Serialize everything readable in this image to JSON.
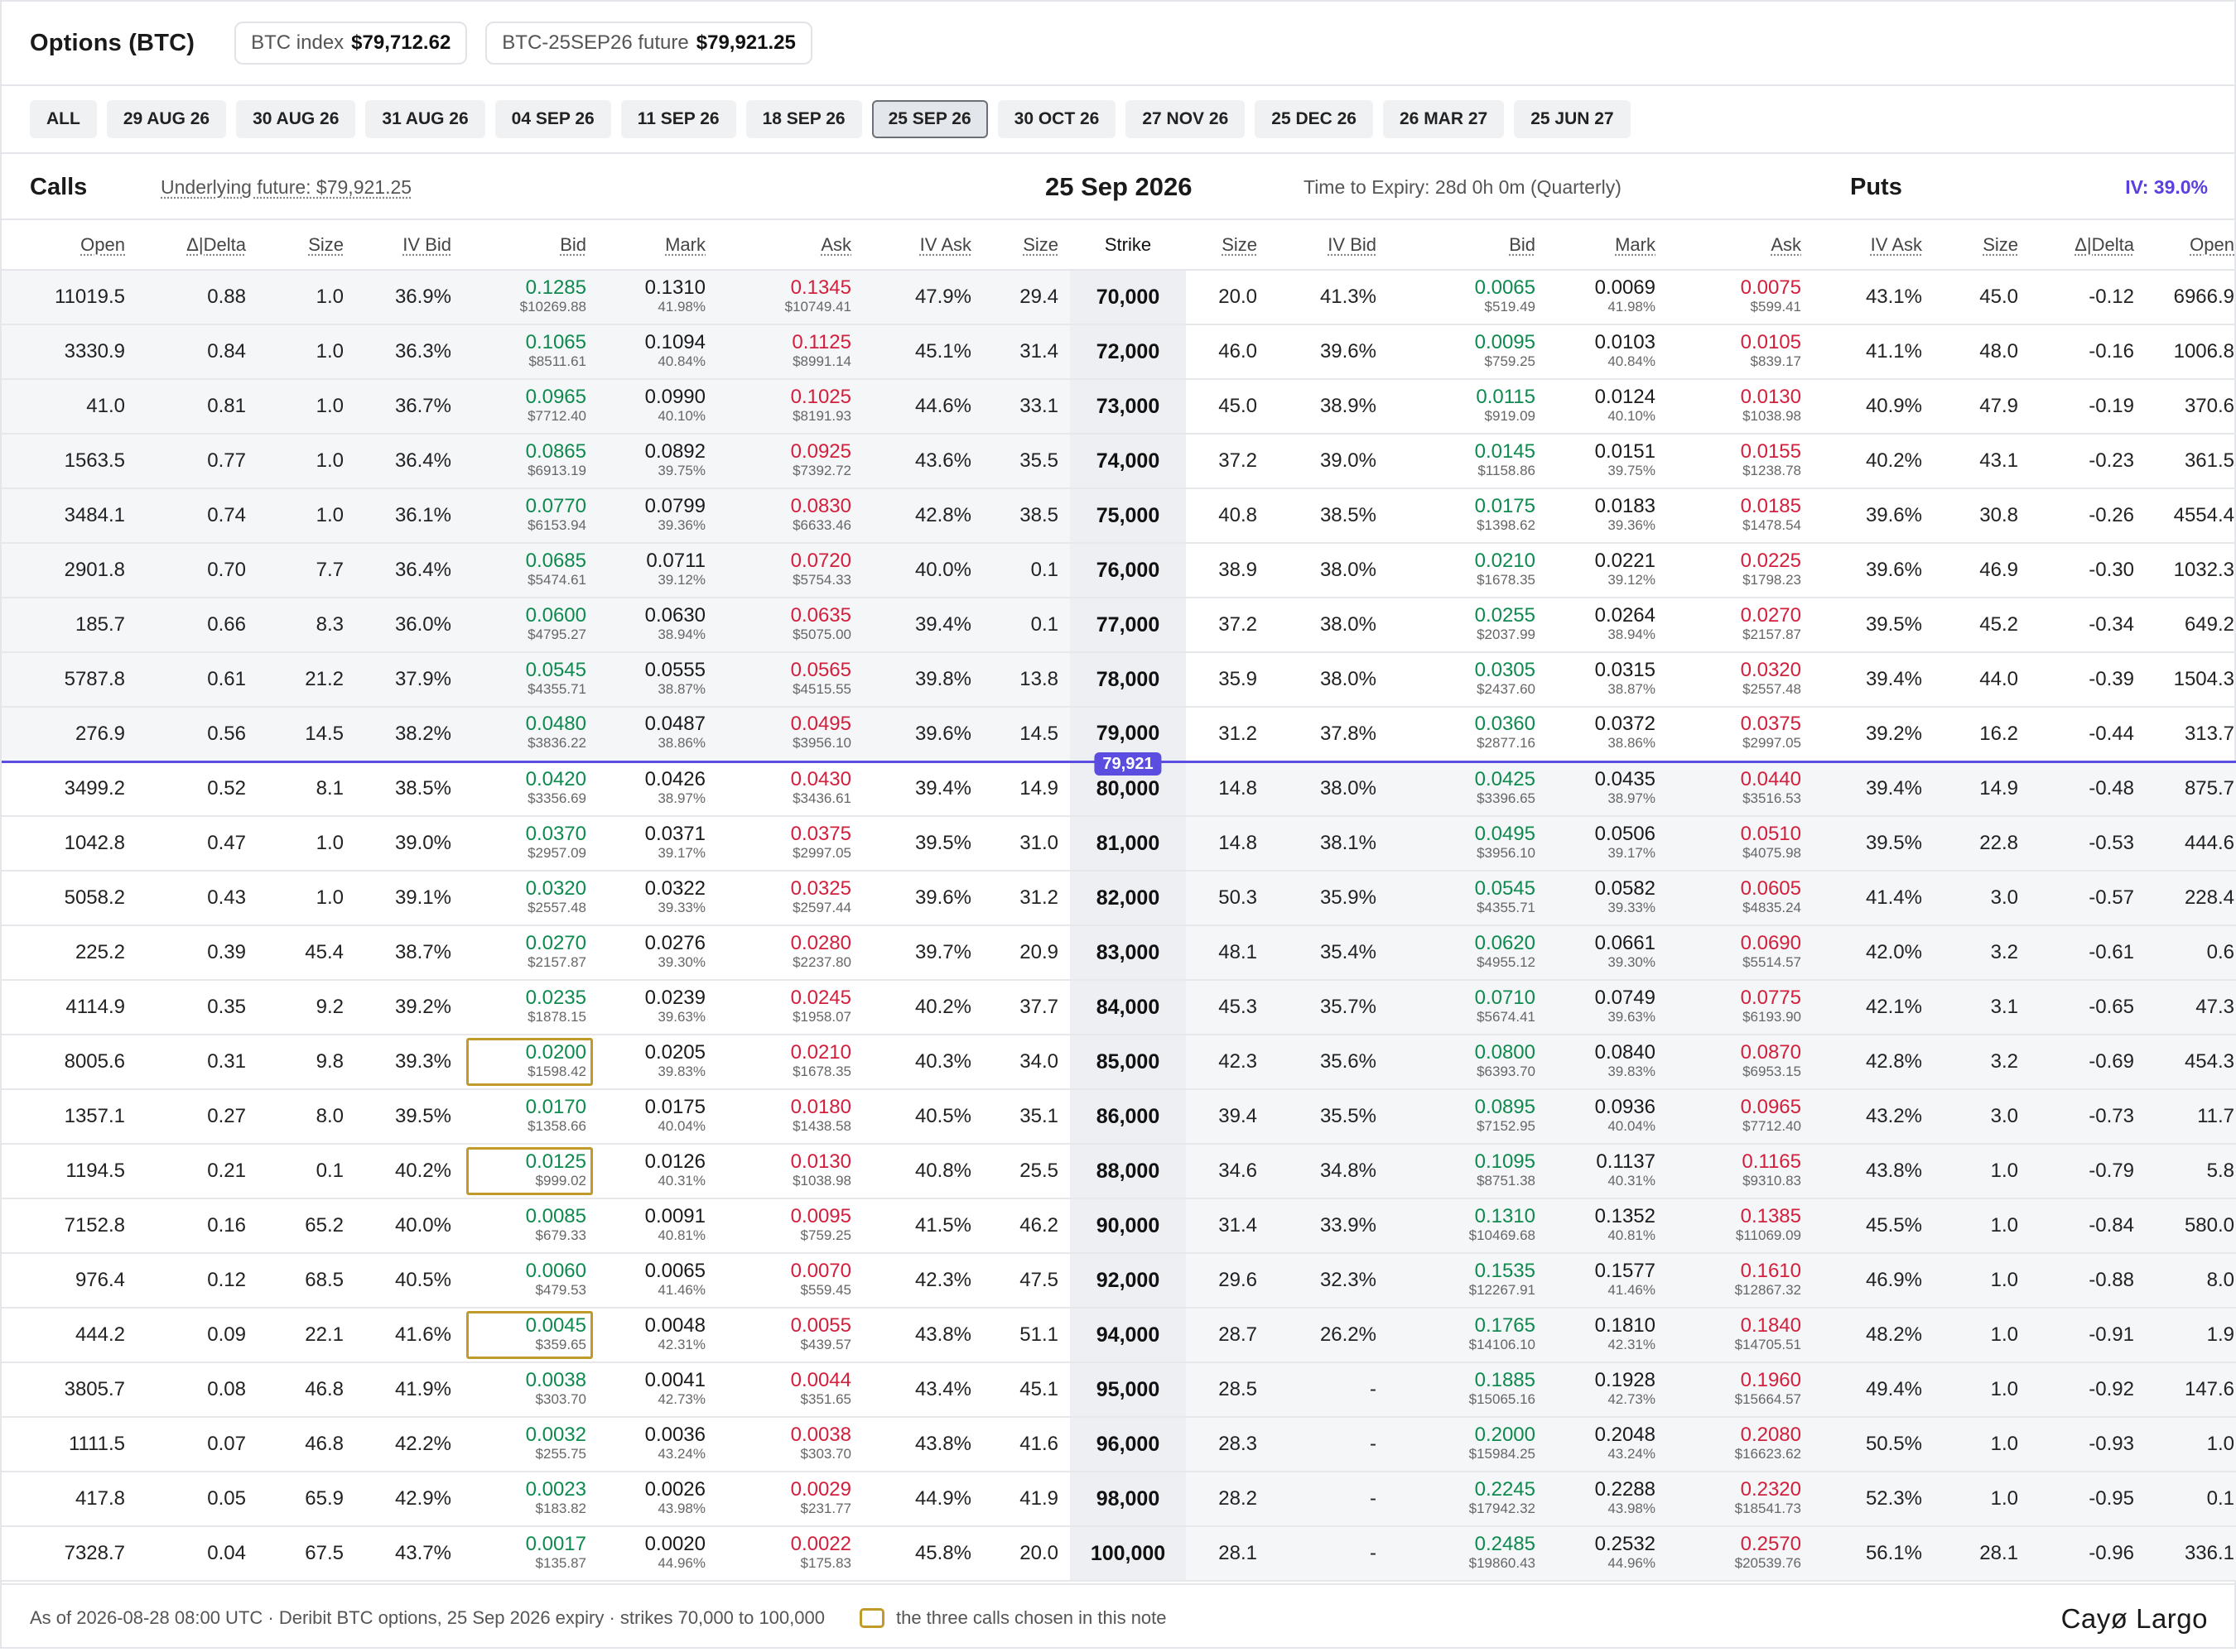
{
  "header": {
    "title": "Options (BTC)",
    "index_label": "BTC index",
    "index_value": "$79,712.62",
    "future_label": "BTC-25SEP26 future",
    "future_value": "$79,921.25"
  },
  "expiries": [
    "ALL",
    "29 AUG 26",
    "30 AUG 26",
    "31 AUG 26",
    "04 SEP 26",
    "11 SEP 26",
    "18 SEP 26",
    "25 SEP 26",
    "30 OCT 26",
    "27 NOV 26",
    "25 DEC 26",
    "26 MAR 27",
    "25 JUN 27"
  ],
  "selected_expiry": "25 SEP 26",
  "section": {
    "calls_label": "Calls",
    "underlying": "Underlying future: $79,921.25",
    "expiry_date": "25 Sep 2026",
    "time_to_expiry": "Time to Expiry: 28d 0h 0m (Quarterly)",
    "puts_label": "Puts",
    "iv": "IV: 39.0%"
  },
  "columns": {
    "calls": [
      "Open",
      "Δ|Delta",
      "Size",
      "IV Bid",
      "Bid",
      "Mark",
      "Ask",
      "IV Ask",
      "Size"
    ],
    "strike": "Strike",
    "puts": [
      "Size",
      "IV Bid",
      "Bid",
      "Mark",
      "Ask",
      "IV Ask",
      "Size",
      "Δ|Delta",
      "Open"
    ]
  },
  "atm_marker": "79,921",
  "highlight_color": "#c29a2a",
  "rows": [
    {
      "strike": "70,000",
      "c": [
        "11019.5",
        "0.88",
        "1.0",
        "36.9%",
        [
          "0.1285",
          "$10269.88"
        ],
        [
          "0.1310",
          "41.98%"
        ],
        [
          "0.1345",
          "$10749.41"
        ],
        "47.9%",
        "29.4"
      ],
      "p": [
        "20.0",
        "41.3%",
        [
          "0.0065",
          "$519.49"
        ],
        [
          "0.0069",
          "41.98%"
        ],
        [
          "0.0075",
          "$599.41"
        ],
        "43.1%",
        "45.0",
        "-0.12",
        "6966.9"
      ]
    },
    {
      "strike": "72,000",
      "c": [
        "3330.9",
        "0.84",
        "1.0",
        "36.3%",
        [
          "0.1065",
          "$8511.61"
        ],
        [
          "0.1094",
          "40.84%"
        ],
        [
          "0.1125",
          "$8991.14"
        ],
        "45.1%",
        "31.4"
      ],
      "p": [
        "46.0",
        "39.6%",
        [
          "0.0095",
          "$759.25"
        ],
        [
          "0.0103",
          "40.84%"
        ],
        [
          "0.0105",
          "$839.17"
        ],
        "41.1%",
        "48.0",
        "-0.16",
        "1006.8"
      ]
    },
    {
      "strike": "73,000",
      "c": [
        "41.0",
        "0.81",
        "1.0",
        "36.7%",
        [
          "0.0965",
          "$7712.40"
        ],
        [
          "0.0990",
          "40.10%"
        ],
        [
          "0.1025",
          "$8191.93"
        ],
        "44.6%",
        "33.1"
      ],
      "p": [
        "45.0",
        "38.9%",
        [
          "0.0115",
          "$919.09"
        ],
        [
          "0.0124",
          "40.10%"
        ],
        [
          "0.0130",
          "$1038.98"
        ],
        "40.9%",
        "47.9",
        "-0.19",
        "370.6"
      ]
    },
    {
      "strike": "74,000",
      "c": [
        "1563.5",
        "0.77",
        "1.0",
        "36.4%",
        [
          "0.0865",
          "$6913.19"
        ],
        [
          "0.0892",
          "39.75%"
        ],
        [
          "0.0925",
          "$7392.72"
        ],
        "43.6%",
        "35.5"
      ],
      "p": [
        "37.2",
        "39.0%",
        [
          "0.0145",
          "$1158.86"
        ],
        [
          "0.0151",
          "39.75%"
        ],
        [
          "0.0155",
          "$1238.78"
        ],
        "40.2%",
        "43.1",
        "-0.23",
        "361.5"
      ]
    },
    {
      "strike": "75,000",
      "c": [
        "3484.1",
        "0.74",
        "1.0",
        "36.1%",
        [
          "0.0770",
          "$6153.94"
        ],
        [
          "0.0799",
          "39.36%"
        ],
        [
          "0.0830",
          "$6633.46"
        ],
        "42.8%",
        "38.5"
      ],
      "p": [
        "40.8",
        "38.5%",
        [
          "0.0175",
          "$1398.62"
        ],
        [
          "0.0183",
          "39.36%"
        ],
        [
          "0.0185",
          "$1478.54"
        ],
        "39.6%",
        "30.8",
        "-0.26",
        "4554.4"
      ]
    },
    {
      "strike": "76,000",
      "c": [
        "2901.8",
        "0.70",
        "7.7",
        "36.4%",
        [
          "0.0685",
          "$5474.61"
        ],
        [
          "0.0711",
          "39.12%"
        ],
        [
          "0.0720",
          "$5754.33"
        ],
        "40.0%",
        "0.1"
      ],
      "p": [
        "38.9",
        "38.0%",
        [
          "0.0210",
          "$1678.35"
        ],
        [
          "0.0221",
          "39.12%"
        ],
        [
          "0.0225",
          "$1798.23"
        ],
        "39.6%",
        "46.9",
        "-0.30",
        "1032.3"
      ]
    },
    {
      "strike": "77,000",
      "c": [
        "185.7",
        "0.66",
        "8.3",
        "36.0%",
        [
          "0.0600",
          "$4795.27"
        ],
        [
          "0.0630",
          "38.94%"
        ],
        [
          "0.0635",
          "$5075.00"
        ],
        "39.4%",
        "0.1"
      ],
      "p": [
        "37.2",
        "38.0%",
        [
          "0.0255",
          "$2037.99"
        ],
        [
          "0.0264",
          "38.94%"
        ],
        [
          "0.0270",
          "$2157.87"
        ],
        "39.5%",
        "45.2",
        "-0.34",
        "649.2"
      ]
    },
    {
      "strike": "78,000",
      "c": [
        "5787.8",
        "0.61",
        "21.2",
        "37.9%",
        [
          "0.0545",
          "$4355.71"
        ],
        [
          "0.0555",
          "38.87%"
        ],
        [
          "0.0565",
          "$4515.55"
        ],
        "39.8%",
        "13.8"
      ],
      "p": [
        "35.9",
        "38.0%",
        [
          "0.0305",
          "$2437.60"
        ],
        [
          "0.0315",
          "38.87%"
        ],
        [
          "0.0320",
          "$2557.48"
        ],
        "39.4%",
        "44.0",
        "-0.39",
        "1504.3"
      ]
    },
    {
      "strike": "79,000",
      "c": [
        "276.9",
        "0.56",
        "14.5",
        "38.2%",
        [
          "0.0480",
          "$3836.22"
        ],
        [
          "0.0487",
          "38.86%"
        ],
        [
          "0.0495",
          "$3956.10"
        ],
        "39.6%",
        "14.5"
      ],
      "p": [
        "31.2",
        "37.8%",
        [
          "0.0360",
          "$2877.16"
        ],
        [
          "0.0372",
          "38.86%"
        ],
        [
          "0.0375",
          "$2997.05"
        ],
        "39.2%",
        "16.2",
        "-0.44",
        "313.7"
      ]
    },
    {
      "strike": "80,000",
      "c": [
        "3499.2",
        "0.52",
        "8.1",
        "38.5%",
        [
          "0.0420",
          "$3356.69"
        ],
        [
          "0.0426",
          "38.97%"
        ],
        [
          "0.0430",
          "$3436.61"
        ],
        "39.4%",
        "14.9"
      ],
      "p": [
        "14.8",
        "38.0%",
        [
          "0.0425",
          "$3396.65"
        ],
        [
          "0.0435",
          "38.97%"
        ],
        [
          "0.0440",
          "$3516.53"
        ],
        "39.4%",
        "14.9",
        "-0.48",
        "875.7"
      ]
    },
    {
      "strike": "81,000",
      "c": [
        "1042.8",
        "0.47",
        "1.0",
        "39.0%",
        [
          "0.0370",
          "$2957.09"
        ],
        [
          "0.0371",
          "39.17%"
        ],
        [
          "0.0375",
          "$2997.05"
        ],
        "39.5%",
        "31.0"
      ],
      "p": [
        "14.8",
        "38.1%",
        [
          "0.0495",
          "$3956.10"
        ],
        [
          "0.0506",
          "39.17%"
        ],
        [
          "0.0510",
          "$4075.98"
        ],
        "39.5%",
        "22.8",
        "-0.53",
        "444.6"
      ]
    },
    {
      "strike": "82,000",
      "c": [
        "5058.2",
        "0.43",
        "1.0",
        "39.1%",
        [
          "0.0320",
          "$2557.48"
        ],
        [
          "0.0322",
          "39.33%"
        ],
        [
          "0.0325",
          "$2597.44"
        ],
        "39.6%",
        "31.2"
      ],
      "p": [
        "50.3",
        "35.9%",
        [
          "0.0545",
          "$4355.71"
        ],
        [
          "0.0582",
          "39.33%"
        ],
        [
          "0.0605",
          "$4835.24"
        ],
        "41.4%",
        "3.0",
        "-0.57",
        "228.4"
      ]
    },
    {
      "strike": "83,000",
      "c": [
        "225.2",
        "0.39",
        "45.4",
        "38.7%",
        [
          "0.0270",
          "$2157.87"
        ],
        [
          "0.0276",
          "39.30%"
        ],
        [
          "0.0280",
          "$2237.80"
        ],
        "39.7%",
        "20.9"
      ],
      "p": [
        "48.1",
        "35.4%",
        [
          "0.0620",
          "$4955.12"
        ],
        [
          "0.0661",
          "39.30%"
        ],
        [
          "0.0690",
          "$5514.57"
        ],
        "42.0%",
        "3.2",
        "-0.61",
        "0.6"
      ]
    },
    {
      "strike": "84,000",
      "c": [
        "4114.9",
        "0.35",
        "9.2",
        "39.2%",
        [
          "0.0235",
          "$1878.15"
        ],
        [
          "0.0239",
          "39.63%"
        ],
        [
          "0.0245",
          "$1958.07"
        ],
        "40.2%",
        "37.7"
      ],
      "p": [
        "45.3",
        "35.7%",
        [
          "0.0710",
          "$5674.41"
        ],
        [
          "0.0749",
          "39.63%"
        ],
        [
          "0.0775",
          "$6193.90"
        ],
        "42.1%",
        "3.1",
        "-0.65",
        "47.3"
      ]
    },
    {
      "strike": "85,000",
      "hl": true,
      "c": [
        "8005.6",
        "0.31",
        "9.8",
        "39.3%",
        [
          "0.0200",
          "$1598.42"
        ],
        [
          "0.0205",
          "39.83%"
        ],
        [
          "0.0210",
          "$1678.35"
        ],
        "40.3%",
        "34.0"
      ],
      "p": [
        "42.3",
        "35.6%",
        [
          "0.0800",
          "$6393.70"
        ],
        [
          "0.0840",
          "39.83%"
        ],
        [
          "0.0870",
          "$6953.15"
        ],
        "42.8%",
        "3.2",
        "-0.69",
        "454.3"
      ]
    },
    {
      "strike": "86,000",
      "c": [
        "1357.1",
        "0.27",
        "8.0",
        "39.5%",
        [
          "0.0170",
          "$1358.66"
        ],
        [
          "0.0175",
          "40.04%"
        ],
        [
          "0.0180",
          "$1438.58"
        ],
        "40.5%",
        "35.1"
      ],
      "p": [
        "39.4",
        "35.5%",
        [
          "0.0895",
          "$7152.95"
        ],
        [
          "0.0936",
          "40.04%"
        ],
        [
          "0.0965",
          "$7712.40"
        ],
        "43.2%",
        "3.0",
        "-0.73",
        "11.7"
      ]
    },
    {
      "strike": "88,000",
      "hl": true,
      "c": [
        "1194.5",
        "0.21",
        "0.1",
        "40.2%",
        [
          "0.0125",
          "$999.02"
        ],
        [
          "0.0126",
          "40.31%"
        ],
        [
          "0.0130",
          "$1038.98"
        ],
        "40.8%",
        "25.5"
      ],
      "p": [
        "34.6",
        "34.8%",
        [
          "0.1095",
          "$8751.38"
        ],
        [
          "0.1137",
          "40.31%"
        ],
        [
          "0.1165",
          "$9310.83"
        ],
        "43.8%",
        "1.0",
        "-0.79",
        "5.8"
      ]
    },
    {
      "strike": "90,000",
      "c": [
        "7152.8",
        "0.16",
        "65.2",
        "40.0%",
        [
          "0.0085",
          "$679.33"
        ],
        [
          "0.0091",
          "40.81%"
        ],
        [
          "0.0095",
          "$759.25"
        ],
        "41.5%",
        "46.2"
      ],
      "p": [
        "31.4",
        "33.9%",
        [
          "0.1310",
          "$10469.68"
        ],
        [
          "0.1352",
          "40.81%"
        ],
        [
          "0.1385",
          "$11069.09"
        ],
        "45.5%",
        "1.0",
        "-0.84",
        "580.0"
      ]
    },
    {
      "strike": "92,000",
      "c": [
        "976.4",
        "0.12",
        "68.5",
        "40.5%",
        [
          "0.0060",
          "$479.53"
        ],
        [
          "0.0065",
          "41.46%"
        ],
        [
          "0.0070",
          "$559.45"
        ],
        "42.3%",
        "47.5"
      ],
      "p": [
        "29.6",
        "32.3%",
        [
          "0.1535",
          "$12267.91"
        ],
        [
          "0.1577",
          "41.46%"
        ],
        [
          "0.1610",
          "$12867.32"
        ],
        "46.9%",
        "1.0",
        "-0.88",
        "8.0"
      ]
    },
    {
      "strike": "94,000",
      "hl": true,
      "c": [
        "444.2",
        "0.09",
        "22.1",
        "41.6%",
        [
          "0.0045",
          "$359.65"
        ],
        [
          "0.0048",
          "42.31%"
        ],
        [
          "0.0055",
          "$439.57"
        ],
        "43.8%",
        "51.1"
      ],
      "p": [
        "28.7",
        "26.2%",
        [
          "0.1765",
          "$14106.10"
        ],
        [
          "0.1810",
          "42.31%"
        ],
        [
          "0.1840",
          "$14705.51"
        ],
        "48.2%",
        "1.0",
        "-0.91",
        "1.9"
      ]
    },
    {
      "strike": "95,000",
      "c": [
        "3805.7",
        "0.08",
        "46.8",
        "41.9%",
        [
          "0.0038",
          "$303.70"
        ],
        [
          "0.0041",
          "42.73%"
        ],
        [
          "0.0044",
          "$351.65"
        ],
        "43.4%",
        "45.1"
      ],
      "p": [
        "28.5",
        "-",
        [
          "0.1885",
          "$15065.16"
        ],
        [
          "0.1928",
          "42.73%"
        ],
        [
          "0.1960",
          "$15664.57"
        ],
        "49.4%",
        "1.0",
        "-0.92",
        "147.6"
      ]
    },
    {
      "strike": "96,000",
      "c": [
        "1111.5",
        "0.07",
        "46.8",
        "42.2%",
        [
          "0.0032",
          "$255.75"
        ],
        [
          "0.0036",
          "43.24%"
        ],
        [
          "0.0038",
          "$303.70"
        ],
        "43.8%",
        "41.6"
      ],
      "p": [
        "28.3",
        "-",
        [
          "0.2000",
          "$15984.25"
        ],
        [
          "0.2048",
          "43.24%"
        ],
        [
          "0.2080",
          "$16623.62"
        ],
        "50.5%",
        "1.0",
        "-0.93",
        "1.0"
      ]
    },
    {
      "strike": "98,000",
      "c": [
        "417.8",
        "0.05",
        "65.9",
        "42.9%",
        [
          "0.0023",
          "$183.82"
        ],
        [
          "0.0026",
          "43.98%"
        ],
        [
          "0.0029",
          "$231.77"
        ],
        "44.9%",
        "41.9"
      ],
      "p": [
        "28.2",
        "-",
        [
          "0.2245",
          "$17942.32"
        ],
        [
          "0.2288",
          "43.98%"
        ],
        [
          "0.2320",
          "$18541.73"
        ],
        "52.3%",
        "1.0",
        "-0.95",
        "0.1"
      ]
    },
    {
      "strike": "100,000",
      "c": [
        "7328.7",
        "0.04",
        "67.5",
        "43.7%",
        [
          "0.0017",
          "$135.87"
        ],
        [
          "0.0020",
          "44.96%"
        ],
        [
          "0.0022",
          "$175.83"
        ],
        "45.8%",
        "20.0"
      ],
      "p": [
        "28.1",
        "-",
        [
          "0.2485",
          "$19860.43"
        ],
        [
          "0.2532",
          "44.96%"
        ],
        [
          "0.2570",
          "$20539.76"
        ],
        "56.1%",
        "28.1",
        "-0.96",
        "336.1"
      ]
    }
  ],
  "footer": {
    "note": "As of 2026-08-28 08:00 UTC · Deribit BTC options, 25 Sep 2026 expiry · strikes 70,000 to 100,000",
    "legend": "the three calls chosen in this note",
    "brand": "Cayø Largo"
  }
}
